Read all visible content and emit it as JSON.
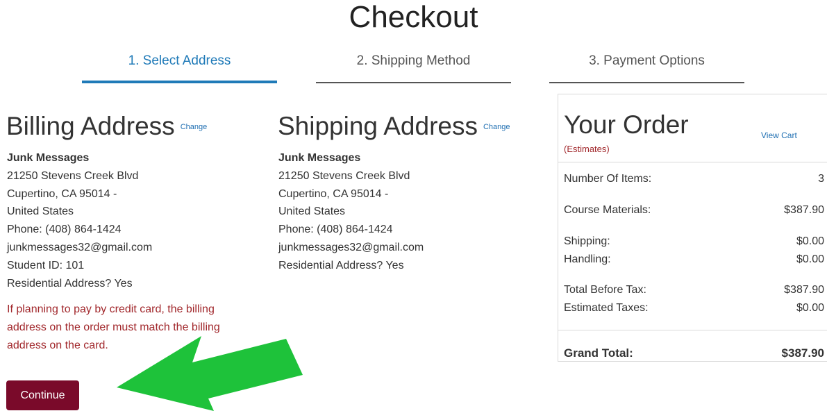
{
  "page_title": "Checkout",
  "tabs": [
    {
      "label": "1. Select Address",
      "active": true
    },
    {
      "label": "2. Shipping Method",
      "active": false
    },
    {
      "label": "3. Payment Options",
      "active": false
    }
  ],
  "billing": {
    "heading": "Billing Address",
    "change": "Change",
    "name": "Junk Messages",
    "lines": [
      "21250 Stevens Creek Blvd",
      "Cupertino, CA 95014 -",
      "United States",
      "Phone: (408) 864-1424",
      "junkmessages32@gmail.com",
      "Student ID: 101",
      "Residential Address? Yes"
    ],
    "notice": "If planning to pay by credit card, the billing address on the order must match the billing address on the card."
  },
  "shipping": {
    "heading": "Shipping Address",
    "change": "Change",
    "name": "Junk Messages",
    "lines": [
      "21250 Stevens Creek Blvd",
      "Cupertino, CA 95014 -",
      "United States",
      "Phone: (408) 864-1424",
      "junkmessages32@gmail.com",
      "Residential Address? Yes"
    ]
  },
  "continue_label": "Continue",
  "order": {
    "title": "Your Order",
    "view_cart": "View Cart",
    "estimates": "(Estimates)",
    "items_label": "Number Of Items:",
    "items_value": "3",
    "materials_label": "Course Materials:",
    "materials_value": "$387.90",
    "shipping_label": "Shipping:",
    "shipping_value": "$0.00",
    "handling_label": "Handling:",
    "handling_value": "$0.00",
    "before_tax_label": "Total Before Tax:",
    "before_tax_value": "$387.90",
    "taxes_label": "Estimated Taxes:",
    "taxes_value": "$0.00",
    "grand_label": "Grand Total:",
    "grand_value": "$387.90"
  },
  "colors": {
    "accent": "#1f7ab8",
    "button": "#7a0a2a",
    "warning": "#a1272b",
    "arrow": "#1ec23a"
  }
}
